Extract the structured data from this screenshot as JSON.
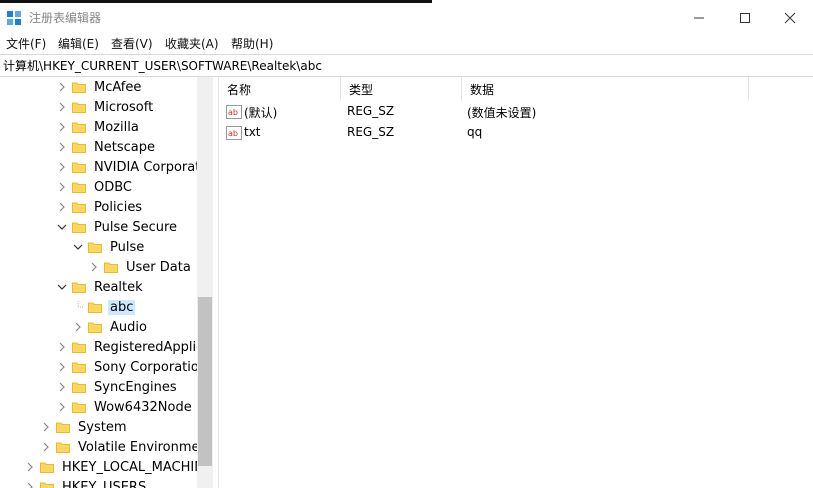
{
  "window": {
    "title": "注册表编辑器"
  },
  "menu": [
    "文件(F)",
    "编辑(E)",
    "查看(V)",
    "收藏夹(A)",
    "帮助(H)"
  ],
  "address": "计算机\\HKEY_CURRENT_USER\\SOFTWARE\\Realtek\\abc",
  "tree": [
    {
      "label": "McAfee",
      "expanded": false
    },
    {
      "label": "Microsoft",
      "expanded": false
    },
    {
      "label": "Mozilla",
      "expanded": false
    },
    {
      "label": "Netscape",
      "expanded": false
    },
    {
      "label": "NVIDIA Corporatic",
      "expanded": false
    },
    {
      "label": "ODBC",
      "expanded": false
    },
    {
      "label": "Policies",
      "expanded": false
    },
    {
      "label": "Pulse Secure",
      "expanded": true
    },
    {
      "label": "Pulse",
      "expanded": true
    },
    {
      "label": "User Data",
      "expanded": false
    },
    {
      "label": "Realtek",
      "expanded": true
    },
    {
      "label": "abc",
      "selected": true
    },
    {
      "label": "Audio",
      "expanded": false
    },
    {
      "label": "RegisteredApplica",
      "expanded": false
    },
    {
      "label": "Sony Corporation",
      "expanded": false
    },
    {
      "label": "SyncEngines",
      "expanded": false
    },
    {
      "label": "Wow6432Node",
      "expanded": false
    },
    {
      "label": "System",
      "expanded": false
    },
    {
      "label": "Volatile Environment",
      "expanded": false
    },
    {
      "label": "HKEY_LOCAL_MACHINE",
      "expanded": false
    },
    {
      "label": "HKEY_USERS",
      "expanded": false
    }
  ],
  "list": {
    "columns": [
      "名称",
      "类型",
      "数据"
    ],
    "rows": [
      {
        "name": "(默认)",
        "type": "REG_SZ",
        "data": "(数值未设置)"
      },
      {
        "name": "txt",
        "type": "REG_SZ",
        "data": "qq"
      }
    ]
  },
  "colors": {
    "selection": "#cce8ff",
    "folder": "#ffd75e",
    "folder_dark": "#e8b931",
    "accent": "#1e7fd6",
    "regicon": "#c8322b"
  }
}
